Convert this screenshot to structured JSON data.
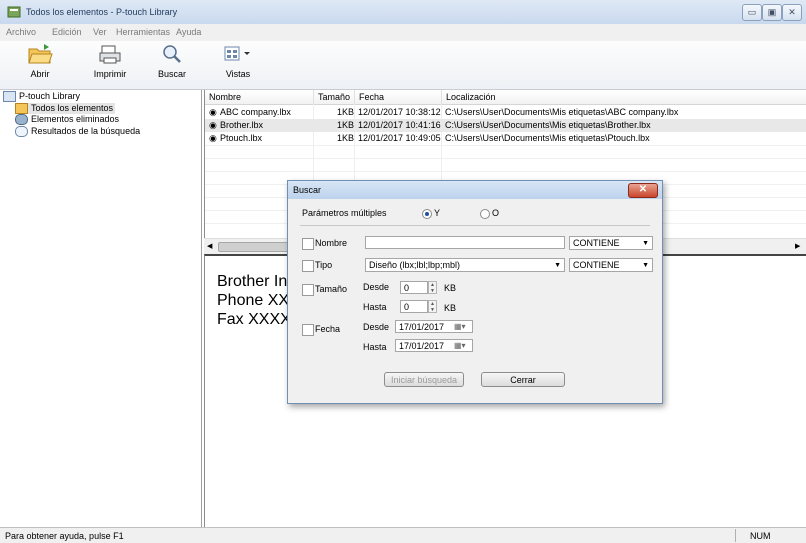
{
  "window": {
    "title": "Todos los elementos - P-touch Library",
    "controls": [
      "minimize-icon",
      "maximize-icon",
      "close-icon"
    ]
  },
  "menu": [
    "Archivo",
    "Edición",
    "Ver",
    "Herramientas",
    "Ayuda"
  ],
  "toolbar": {
    "open_label": "Abrir",
    "print_label": "Imprimir",
    "search_label": "Buscar",
    "views_label": "Vistas"
  },
  "tree": {
    "root": "P-touch Library",
    "items": [
      "Todos los elementos",
      "Elementos eliminados",
      "Resultados de la búsqueda"
    ]
  },
  "list": {
    "columns": [
      "Nombre",
      "Tamaño",
      "Fecha",
      "Localización"
    ],
    "rows": [
      {
        "name": "ABC company.lbx",
        "size": "1KB",
        "date": "12/01/2017 10:38:12",
        "location": "C:\\Users\\User\\Documents\\Mis etiquetas\\ABC company.lbx"
      },
      {
        "name": "Brother.lbx",
        "size": "1KB",
        "date": "12/01/2017 10:41:16",
        "location": "C:\\Users\\User\\Documents\\Mis etiquetas\\Brother.lbx"
      },
      {
        "name": "Ptouch.lbx",
        "size": "1KB",
        "date": "12/01/2017 10:49:05",
        "location": "C:\\Users\\User\\Documents\\Mis etiquetas\\Ptouch.lbx"
      }
    ]
  },
  "preview": {
    "lines": [
      "Brother In",
      "Phone XX",
      "Fax XXXX"
    ]
  },
  "status": {
    "help_text": "Para obtener ayuda, pulse F1",
    "num": "NUM"
  },
  "dialog": {
    "title": "Buscar",
    "params_label": "Parámetros múltiples",
    "radio_and": "Y",
    "radio_or": "O",
    "name_label": "Nombre",
    "name_value": "",
    "name_condition": "CONTIENE",
    "type_label": "Tipo",
    "type_value": "Diseño (lbx;lbl;lbp;mbl)",
    "type_condition": "CONTIENE",
    "size_label": "Tamaño",
    "from_label": "Desde",
    "to_label": "Hasta",
    "size_from": "0",
    "size_to": "0",
    "kb_unit": "KB",
    "date_label": "Fecha",
    "date_from": "17/01/2017",
    "date_to": "17/01/2017",
    "start_button": "Iniciar búsqueda",
    "close_button": "Cerrar"
  },
  "colors": {
    "titlebar": "#c9d9ee",
    "selected_row": "#e8e8e8",
    "dialog_close": "#c9452b"
  }
}
